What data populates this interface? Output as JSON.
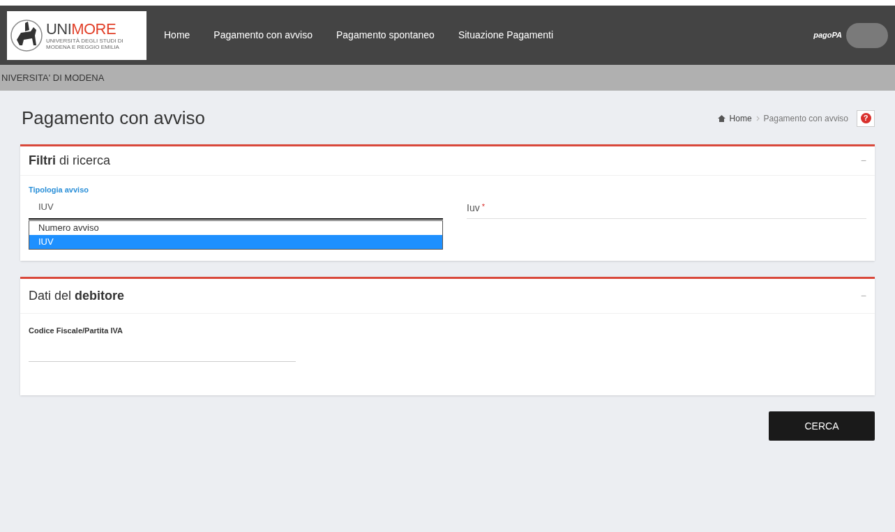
{
  "header": {
    "logo": {
      "wordmark": [
        "UNI",
        "MORE"
      ],
      "subtitle": [
        "UNIVERSITÀ DEGLI STUDI DI",
        "MODENA E REGGIO EMILIA"
      ]
    },
    "nav": [
      {
        "label": "Home"
      },
      {
        "label": "Pagamento con avviso"
      },
      {
        "label": "Pagamento spontaneo"
      },
      {
        "label": "Situazione Pagamenti"
      }
    ],
    "brand": "pagoPA"
  },
  "banner": "NIVERSITA' DI MODENA",
  "page_title": "Pagamento con avviso",
  "breadcrumb": [
    "Home",
    "Pagamento con avviso"
  ],
  "help": "?",
  "filters": {
    "title": "**Filtri** di ricerca",
    "collapse": "−",
    "type_label": "Tipologia avviso",
    "type_value": "IUV",
    "options": [
      {
        "label": "Numero avviso",
        "selected": false
      },
      {
        "label": "IUV",
        "selected": true
      }
    ],
    "iuv_label": "Iuv",
    "required": "*"
  },
  "debtor": {
    "title": "Dati del **debitore**",
    "collapse": "−",
    "field_label": "Codice Fiscale/Partita IVA"
  },
  "search_button": "CERCA"
}
